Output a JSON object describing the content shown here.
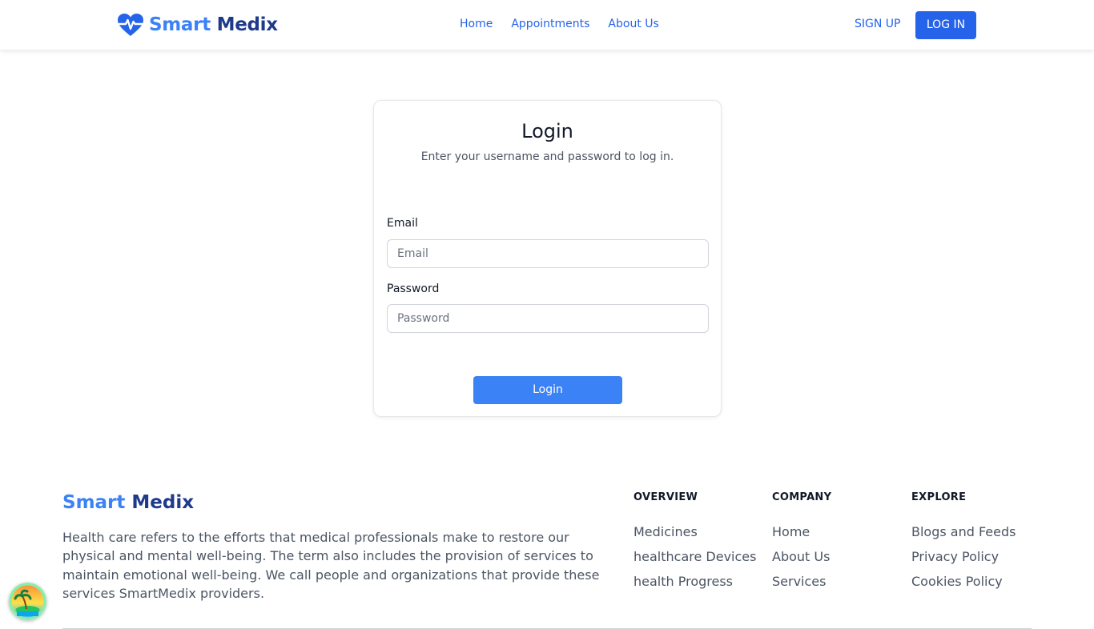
{
  "header": {
    "logo": {
      "smart": "Smart",
      "medix": "Medix"
    },
    "nav": [
      {
        "label": "Home"
      },
      {
        "label": "Appointments"
      },
      {
        "label": "About Us"
      }
    ],
    "signup_label": "SIGN UP",
    "login_label": "LOG IN"
  },
  "login_card": {
    "title": "Login",
    "subtitle": "Enter your username and password to log in.",
    "email": {
      "label": "Email",
      "placeholder": "Email",
      "value": ""
    },
    "password": {
      "label": "Password",
      "placeholder": "Password",
      "value": ""
    },
    "submit_label": "Login"
  },
  "footer": {
    "logo": {
      "smart": "Smart",
      "medix": "Medix"
    },
    "description": "Health care refers to the efforts that medical professionals make to restore our physical and mental well-being. The term also includes the provision of services to maintain emotional well-being. We call people and organizations that provide these services SmartMedix providers.",
    "columns": [
      {
        "heading": "OVERVIEW",
        "links": [
          "Medicines",
          "healthcare Devices",
          "health Progress"
        ]
      },
      {
        "heading": "COMPANY",
        "links": [
          "Home",
          "About Us",
          "Services"
        ]
      },
      {
        "heading": "EXPLORE",
        "links": [
          "Blogs and Feeds",
          "Privacy Policy",
          "Cookies Policy"
        ]
      }
    ]
  },
  "colors": {
    "primary": "#2563eb",
    "button": "#3b82f6",
    "brand_dark": "#1e3a8a"
  },
  "icons": {
    "logo": "heart-pulse-icon",
    "floating": "island-icon"
  }
}
